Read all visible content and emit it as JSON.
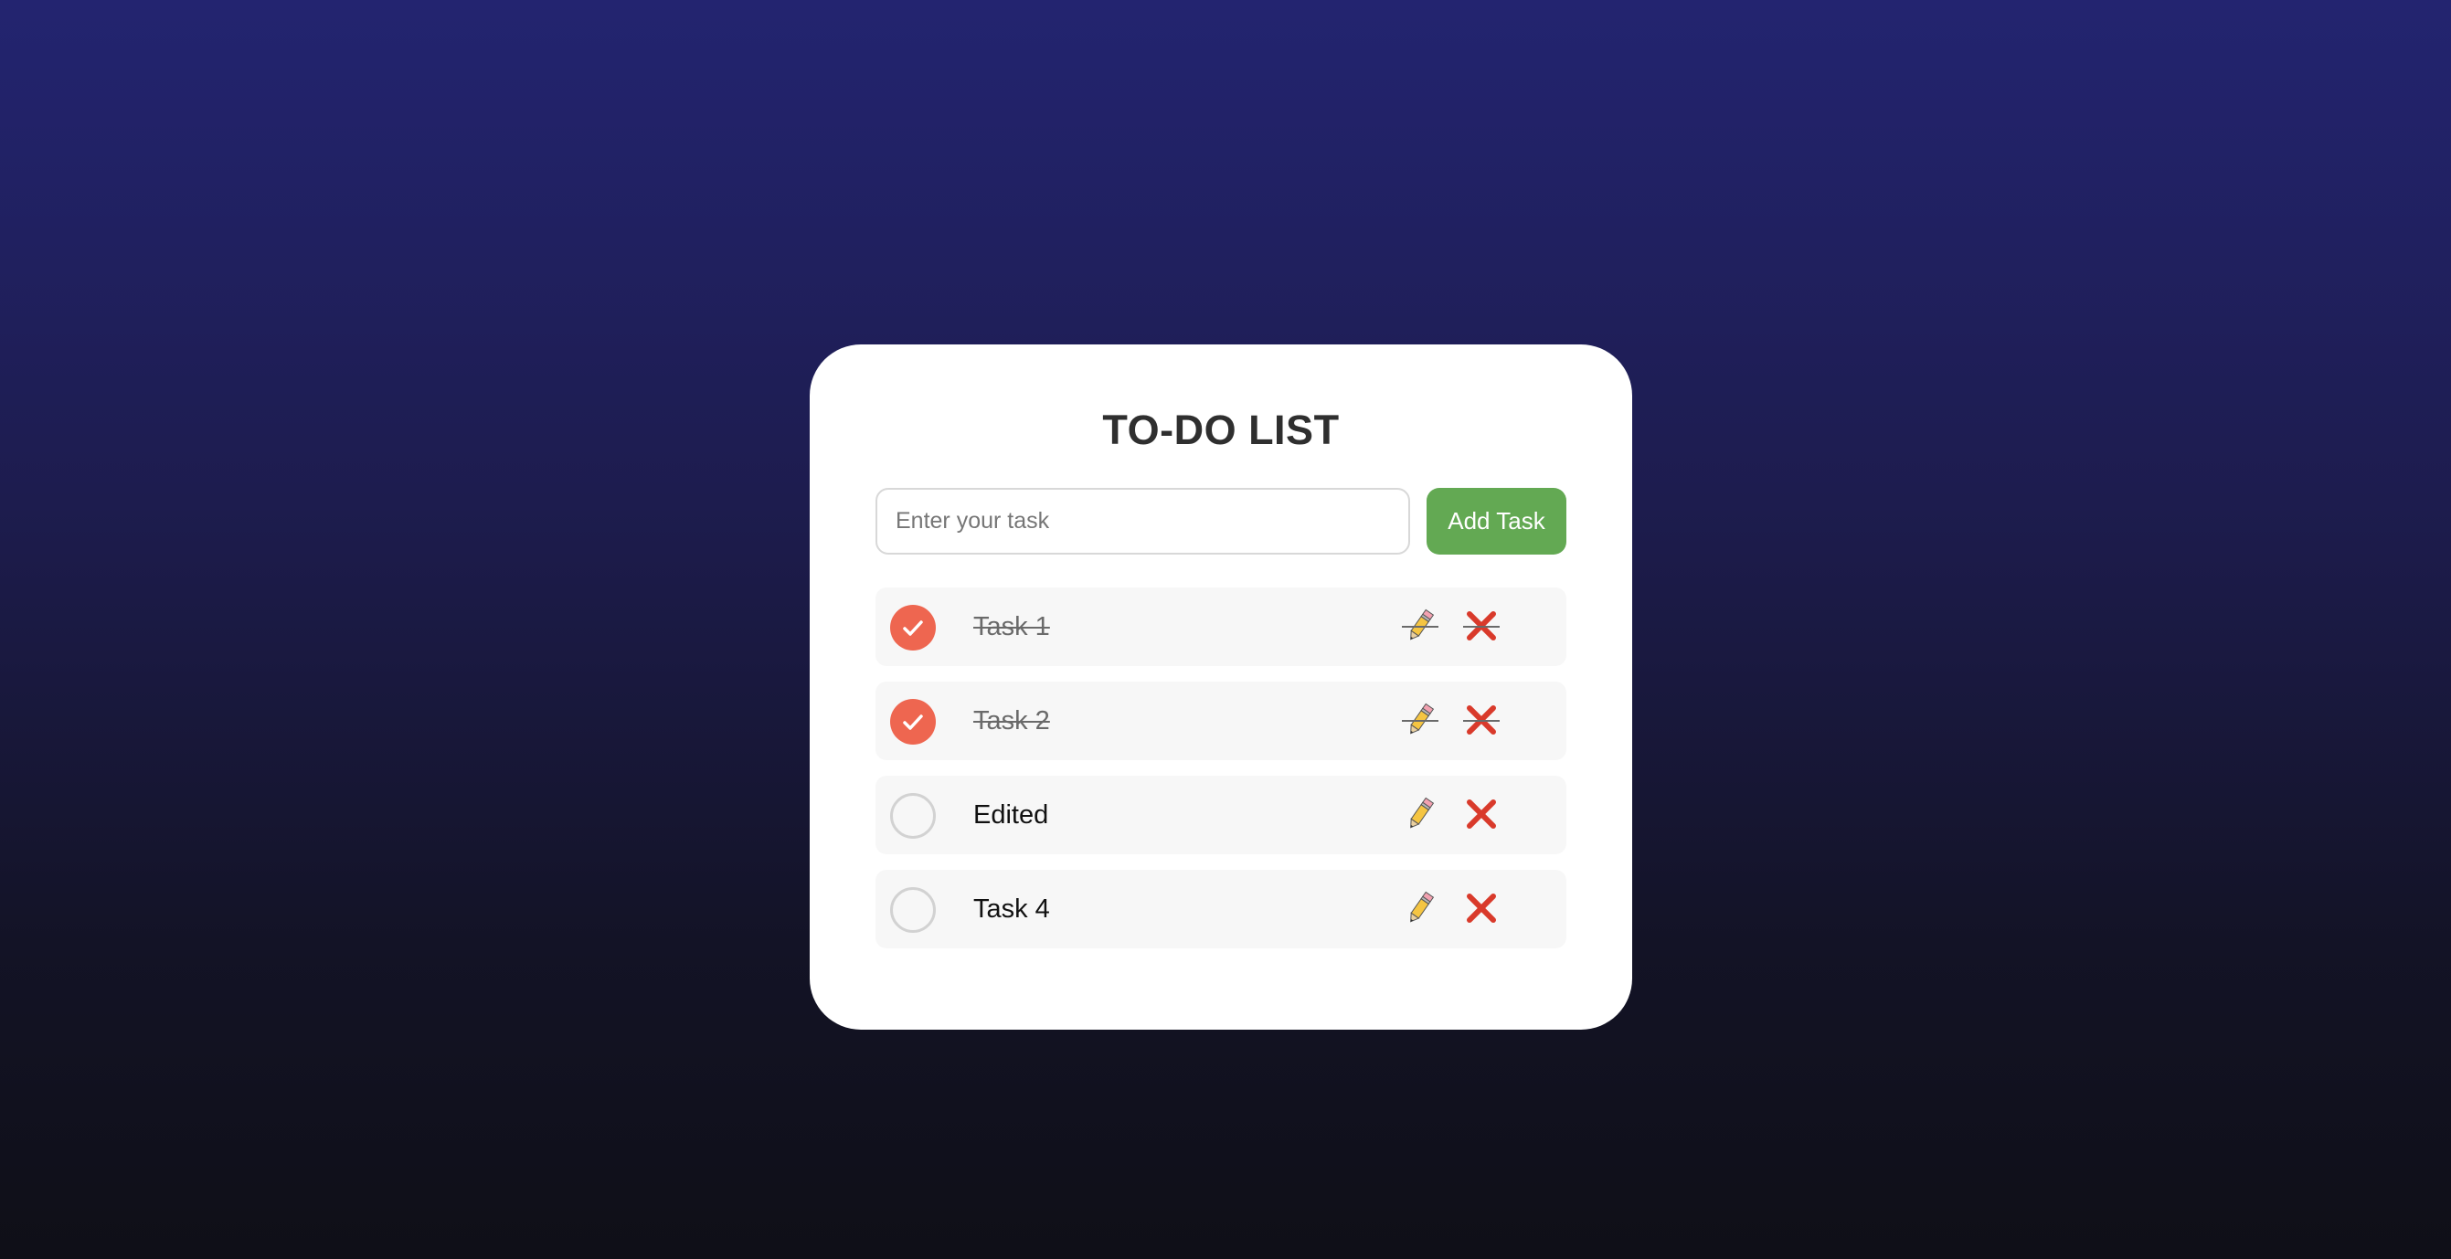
{
  "app": {
    "title": "TO-DO LIST"
  },
  "input": {
    "placeholder": "Enter your task",
    "value": ""
  },
  "add_button": {
    "label": "Add Task"
  },
  "tasks": [
    {
      "text": "Task 1",
      "completed": true
    },
    {
      "text": "Task 2",
      "completed": true
    },
    {
      "text": "Edited",
      "completed": false
    },
    {
      "text": "Task 4",
      "completed": false
    }
  ],
  "icons": {
    "check": "checkmark-icon",
    "edit": "pencil-icon",
    "delete": "cross-icon"
  },
  "colors": {
    "accent_check": "#ee6650",
    "add_button": "#63a953",
    "delete": "#d93a2b"
  }
}
